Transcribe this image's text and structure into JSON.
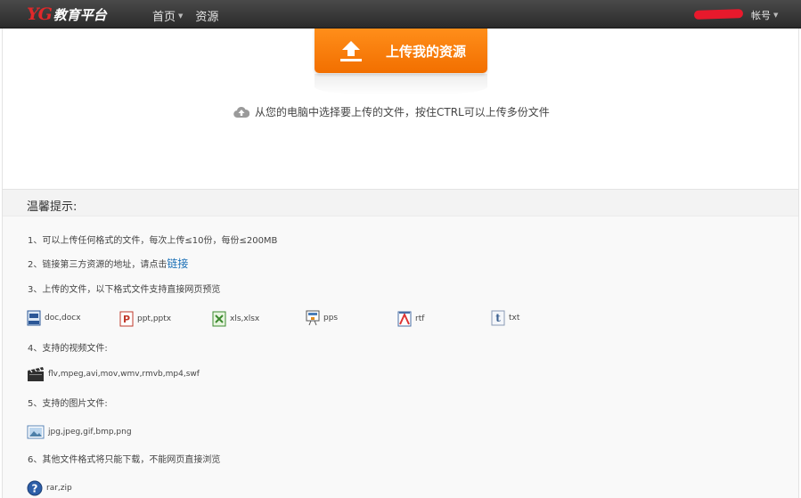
{
  "header": {
    "logo_mark": "YG",
    "logo_text": "教育平台",
    "nav": [
      {
        "label": "首页",
        "has_caret": true
      },
      {
        "label": "资源",
        "has_caret": false
      }
    ],
    "account_label": "帐号"
  },
  "upload": {
    "button_label": "上传我的资源",
    "hint": "从您的电脑中选择要上传的文件，按住CTRL可以上传多份文件"
  },
  "tips": {
    "title": "温馨提示:",
    "line1": "1、可以上传任何格式的文件，每次上传≤10份，每份≤200MB",
    "line2_prefix": "2、链接第三方资源的地址，请点击",
    "line2_link": "链接",
    "line3": "3、上传的文件，以下格式文件支持直接网页预览",
    "doc_formats": [
      {
        "icon": "word-doc-icon",
        "label": "doc,docx"
      },
      {
        "icon": "powerpoint-icon",
        "label": "ppt,pptx"
      },
      {
        "icon": "excel-icon",
        "label": "xls,xlsx"
      },
      {
        "icon": "pps-icon",
        "label": "pps"
      },
      {
        "icon": "rtf-icon",
        "label": "rtf"
      },
      {
        "icon": "txt-icon",
        "label": "txt"
      }
    ],
    "line4": "4、支持的视频文件:",
    "video_formats": "flv,mpeg,avi,mov,wmv,rmvb,mp4,swf",
    "line5": "5、支持的图片文件:",
    "image_formats": "jpg,jpeg,gif,bmp,png",
    "line6": "6、其他文件格式将只能下载，不能网页直接浏览",
    "other_formats": "rar,zip"
  },
  "colors": {
    "accent_orange": "#f57c00",
    "link_blue": "#1a6fb5",
    "logo_red": "#e0282a"
  }
}
